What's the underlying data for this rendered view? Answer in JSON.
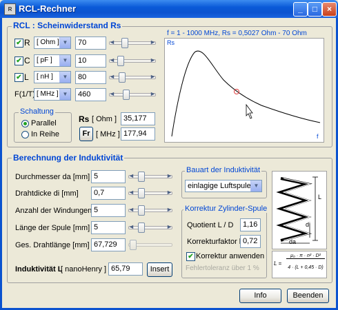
{
  "window": {
    "title": "RCL-Rechner",
    "icon": "app-icon"
  },
  "rcl": {
    "section_title": "RCL : Scheinwiderstand Rs",
    "rows": [
      {
        "label": "R",
        "checked": true,
        "unit": "[ Ohm ]",
        "value": "70"
      },
      {
        "label": "C",
        "checked": true,
        "unit": "[ pF ]",
        "value": "10"
      },
      {
        "label": "L",
        "checked": true,
        "unit": "[ nH ]",
        "value": "80"
      },
      {
        "label": "F(1/T)",
        "unit": "[ MHz ]",
        "value": "460"
      }
    ],
    "schaltung": {
      "title": "Schaltung",
      "options": [
        "Parallel",
        "In Reihe"
      ],
      "selected": "Parallel"
    },
    "rs_label": "Rs",
    "rs_unit": "[ Ohm ]",
    "rs_value": "35,177",
    "fr_label": "Fr",
    "fr_unit": "[ MHz ]",
    "fr_value": "177,94"
  },
  "graph": {
    "caption": "f = 1 - 1000 MHz, Rs = 0,5027 Ohm - 70 Ohm",
    "ylabel": "Rs",
    "xlabel": "f"
  },
  "induktivitaet": {
    "section_title": "Berechnung der Induktivität",
    "rows": [
      {
        "label": "Durchmesser da [mm]",
        "value": "5"
      },
      {
        "label": "Drahtdicke di [mm]",
        "value": "0,7"
      },
      {
        "label": "Anzahl der Windungen",
        "value": "5"
      },
      {
        "label": "Länge der Spule [mm]",
        "value": "5"
      },
      {
        "label": "Ges. Drahtlänge  [mm]",
        "value": "67,729"
      }
    ],
    "result_label": "Induktivität L",
    "result_unit": "[ nanoHenry ]",
    "result_value": "65,79",
    "insert_label": "Insert"
  },
  "bauart": {
    "title": "Bauart der Induktivität",
    "selected": "einlagige Luftspule"
  },
  "korrektur": {
    "title": "Korrektur Zylinder-Spule",
    "quotient_label": "Quotient L / D",
    "quotient_value": "1,16",
    "faktor_label": "Korrekturfaktor k",
    "faktor_value": "0,72",
    "anwenden_label": "Korrektur anwenden",
    "anwenden_checked": true,
    "fehler_text": "Fehlertoleranz über 1 %"
  },
  "coil": {
    "L_label": "L",
    "di_label": "di",
    "da_label": "da",
    "formula_lhs": "L =",
    "formula_num": "μ₀ · π · n² · D²",
    "formula_den": "4 · (L + 0,45 · D)"
  },
  "buttons": {
    "info": "Info",
    "beenden": "Beenden"
  }
}
